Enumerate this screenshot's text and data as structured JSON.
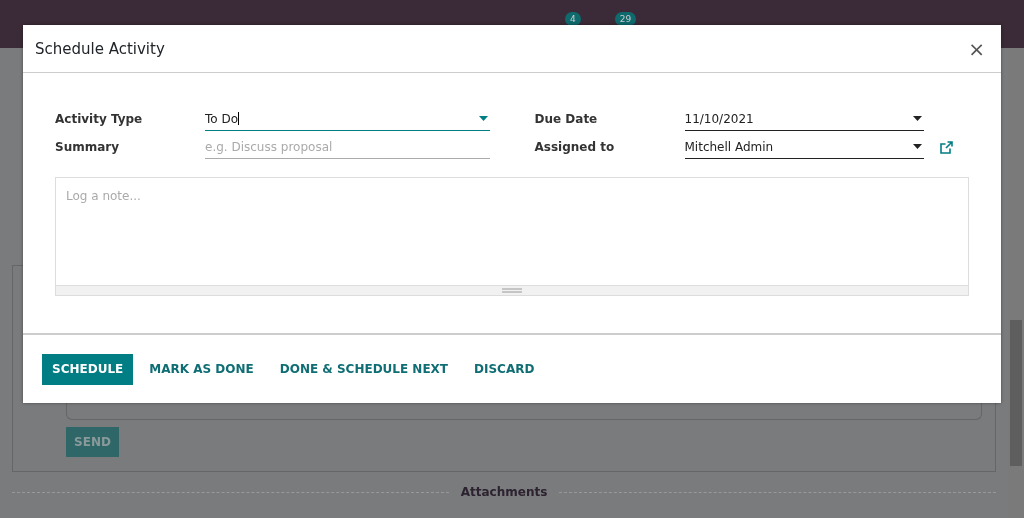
{
  "navbar": {
    "badges": [
      {
        "count": "4"
      },
      {
        "count": "29"
      }
    ]
  },
  "background": {
    "send_button": "SEND",
    "divider_label": "Attachments"
  },
  "dialog": {
    "title": "Schedule Activity",
    "close": "×",
    "left_fields": [
      {
        "label": "Activity Type",
        "kind": "select",
        "value": "To Do",
        "focused": true
      },
      {
        "label": "Summary",
        "kind": "text",
        "placeholder": "e.g. Discuss proposal",
        "focused": false
      }
    ],
    "right_fields": [
      {
        "label": "Due Date",
        "kind": "select",
        "value": "11/10/2021",
        "focused": false,
        "external_link": false
      },
      {
        "label": "Assigned to",
        "kind": "select",
        "value": "Mitchell Admin",
        "focused": false,
        "external_link": true
      }
    ],
    "note": {
      "placeholder": "Log a note..."
    },
    "buttons": [
      {
        "label": "SCHEDULE",
        "primary": true
      },
      {
        "label": "MARK AS DONE",
        "primary": false
      },
      {
        "label": "DONE & SCHEDULE NEXT",
        "primary": false
      },
      {
        "label": "DISCARD",
        "primary": false
      }
    ]
  }
}
